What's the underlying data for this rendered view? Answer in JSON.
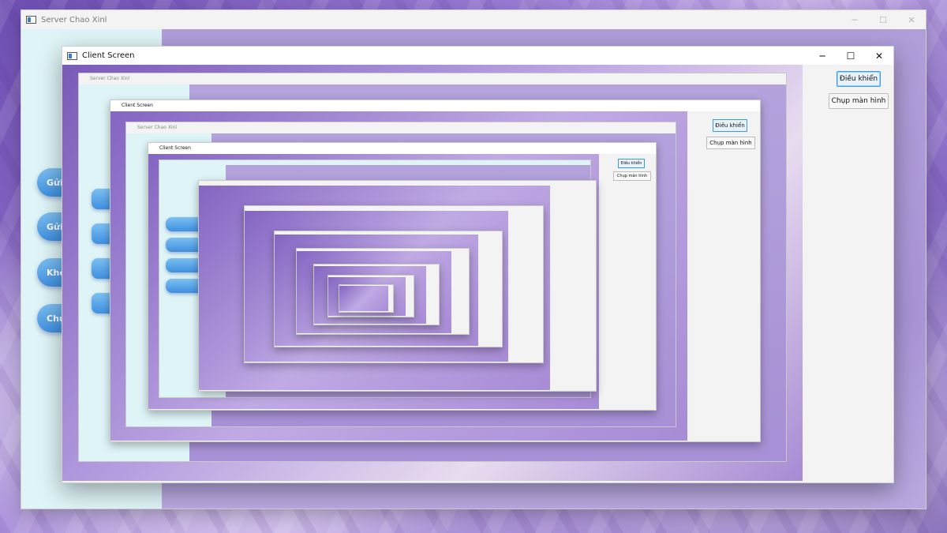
{
  "server_window": {
    "title": "Server Chao Xinl",
    "controls": {
      "minimize": "─",
      "maximize": "☐",
      "close": "✕"
    },
    "sidebar_buttons": [
      "Gửi bài",
      "Gửi thông",
      "Khóa máy",
      "Chụp màn hình"
    ]
  },
  "client_window": {
    "title": "Client Screen",
    "controls": {
      "minimize": "─",
      "maximize": "☐",
      "close": "✕"
    },
    "panel": {
      "control_button": "Điều khiển",
      "capture_button": "Chụp màn hình"
    }
  }
}
